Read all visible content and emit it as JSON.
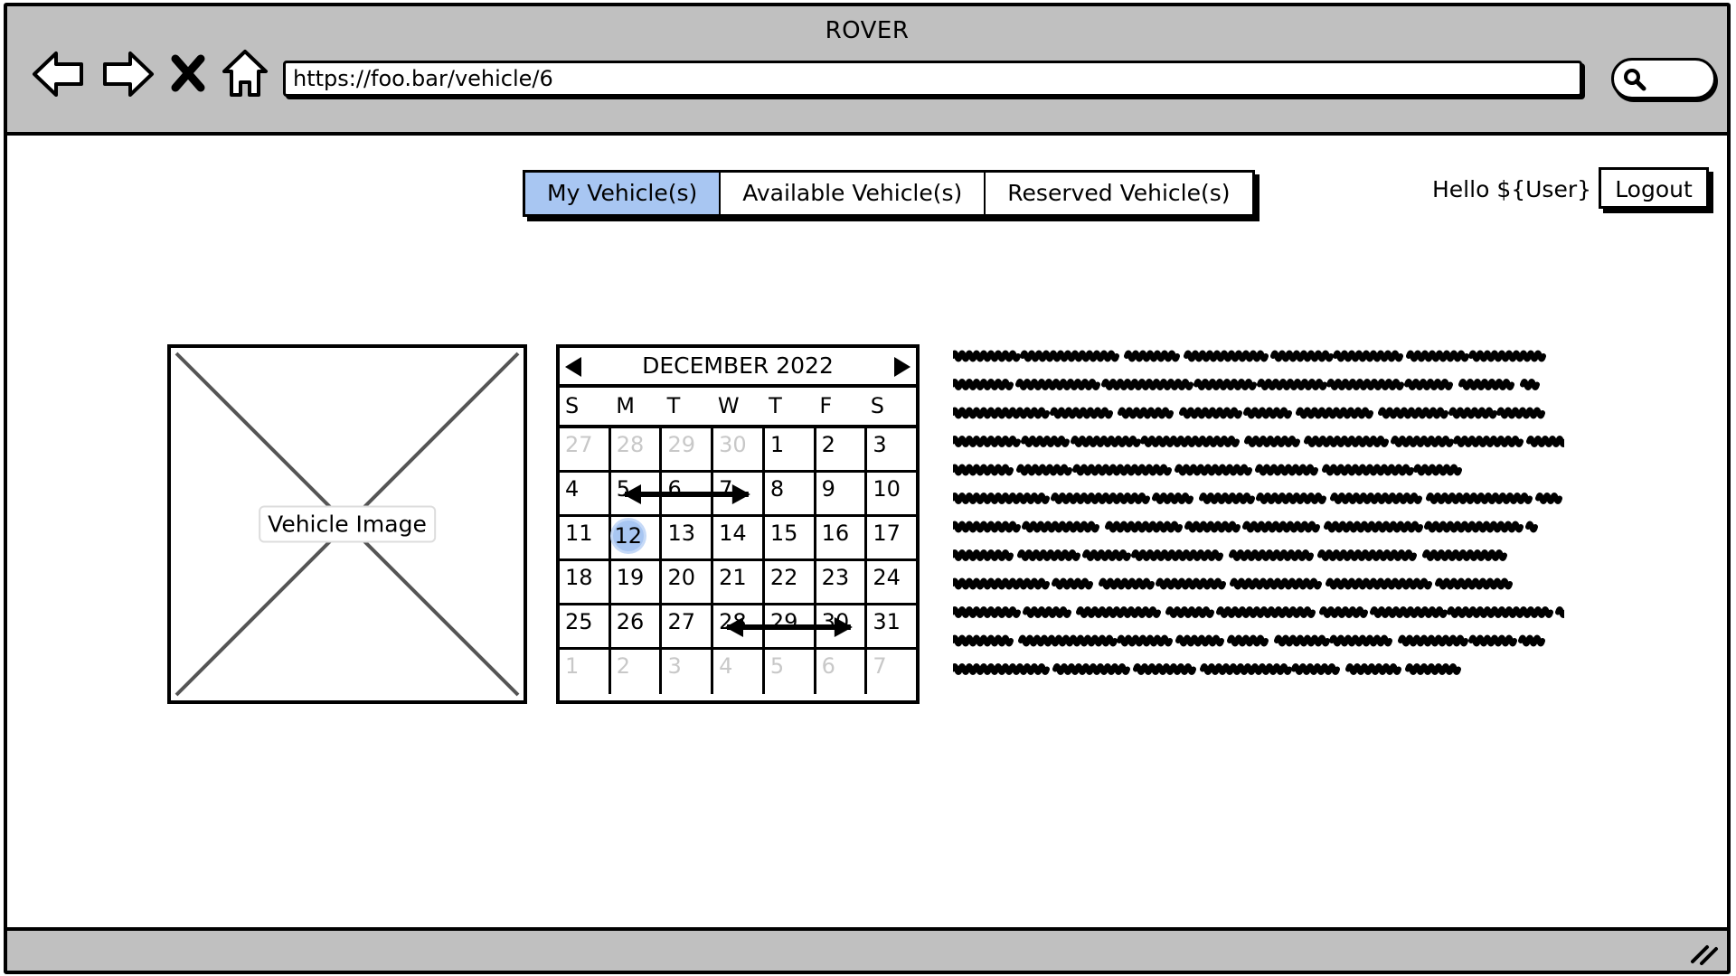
{
  "window": {
    "title": "ROVER"
  },
  "browser": {
    "url": "https://foo.bar/vehicle/6",
    "nav_icons": [
      "back-arrow-icon",
      "forward-arrow-icon",
      "stop-icon",
      "home-icon"
    ],
    "search_icon": "search-icon"
  },
  "tabs": [
    {
      "label": "My Vehicle(s)",
      "active": true
    },
    {
      "label": "Available Vehicle(s)",
      "active": false
    },
    {
      "label": "Reserved Vehicle(s)",
      "active": false
    }
  ],
  "user": {
    "greeting": "Hello ${User}",
    "logout_label": "Logout"
  },
  "vehicle_image": {
    "label": "Vehicle Image"
  },
  "calendar": {
    "month_label": "DECEMBER 2022",
    "weekdays": [
      "S",
      "M",
      "T",
      "W",
      "T",
      "F",
      "S"
    ],
    "today": 12,
    "weeks": [
      [
        {
          "d": "27",
          "m": true
        },
        {
          "d": "28",
          "m": true
        },
        {
          "d": "29",
          "m": true
        },
        {
          "d": "30",
          "m": true
        },
        {
          "d": "1"
        },
        {
          "d": "2"
        },
        {
          "d": "3"
        }
      ],
      [
        {
          "d": "4"
        },
        {
          "d": "5"
        },
        {
          "d": "6"
        },
        {
          "d": "7"
        },
        {
          "d": "8"
        },
        {
          "d": "9"
        },
        {
          "d": "10"
        }
      ],
      [
        {
          "d": "11"
        },
        {
          "d": "12",
          "t": true
        },
        {
          "d": "13"
        },
        {
          "d": "14"
        },
        {
          "d": "15"
        },
        {
          "d": "16"
        },
        {
          "d": "17"
        }
      ],
      [
        {
          "d": "18"
        },
        {
          "d": "19"
        },
        {
          "d": "20"
        },
        {
          "d": "21"
        },
        {
          "d": "22"
        },
        {
          "d": "23"
        },
        {
          "d": "24"
        }
      ],
      [
        {
          "d": "25"
        },
        {
          "d": "26"
        },
        {
          "d": "27"
        },
        {
          "d": "28"
        },
        {
          "d": "29"
        },
        {
          "d": "30"
        },
        {
          "d": "31"
        }
      ],
      [
        {
          "d": "1",
          "m": true
        },
        {
          "d": "2",
          "m": true
        },
        {
          "d": "3",
          "m": true
        },
        {
          "d": "4",
          "m": true
        },
        {
          "d": "5",
          "m": true
        },
        {
          "d": "6",
          "m": true
        },
        {
          "d": "7",
          "m": true
        }
      ]
    ],
    "reserved_ranges": [
      {
        "from": 5,
        "to": 7
      },
      {
        "from": 28,
        "to": 30
      }
    ]
  },
  "colors": {
    "accent": "#a8c6f2",
    "chrome": "#c0c0c0",
    "muted_day": "#c8c8c8"
  }
}
